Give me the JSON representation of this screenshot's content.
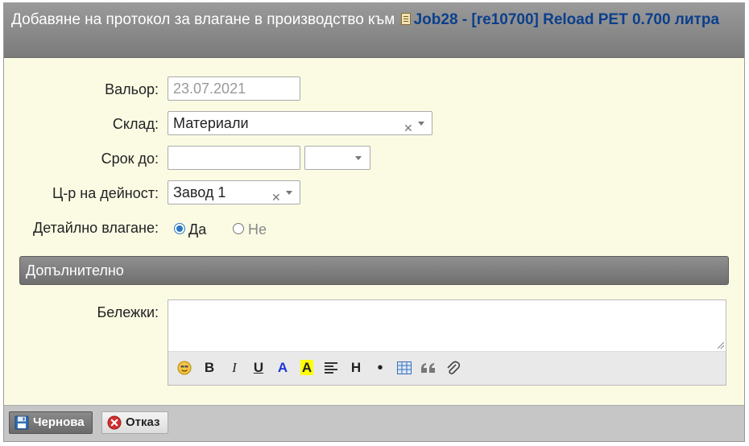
{
  "title": {
    "prefix": "Добавяне на протокол за влагане в производство към",
    "link": "Job28 - [re10700] Reload PET 0.700 литра"
  },
  "form": {
    "valor": {
      "label": "Вальор:",
      "value": "23.07.2021"
    },
    "sklad": {
      "label": "Склад:",
      "value": "Материали"
    },
    "srok": {
      "label": "Срок до:",
      "value": "",
      "time_value": ""
    },
    "center": {
      "label": "Ц-р на дейност:",
      "value": "Завод 1"
    },
    "detailed": {
      "label": "Детайлно влагане:",
      "options": [
        "Да",
        "Не"
      ],
      "selected": "Да"
    }
  },
  "section": {
    "title": "Допълнително"
  },
  "notes": {
    "label": "Бележки:",
    "value": ""
  },
  "toolbar": {
    "items": [
      "smiley-icon",
      "B",
      "I",
      "U",
      "A",
      "A",
      "align-icon",
      "H",
      "•",
      "table-icon",
      "quote-icon",
      "attach-icon"
    ],
    "bold": "B",
    "italic": "I",
    "underline": "U",
    "font_color": "A",
    "bg_color": "A",
    "heading": "H",
    "bullet": "•",
    "colors": {
      "font_color": "#1b37d6",
      "bg_color": "#ffff00"
    }
  },
  "footer": {
    "draft_label": "Чернова",
    "cancel_label": "Отказ"
  },
  "colors": {
    "title_link": "#0b3f8c",
    "radio_accent": "#2b78c4",
    "panel_bg": "#fbfbe4"
  }
}
